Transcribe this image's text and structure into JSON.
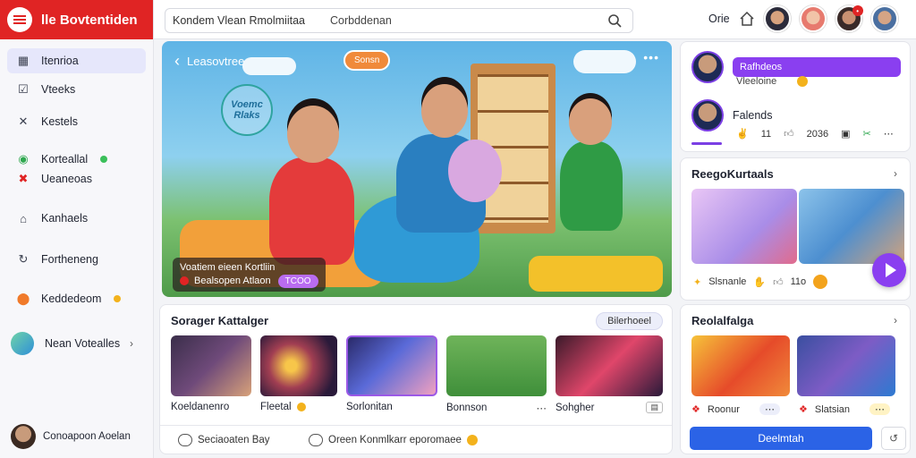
{
  "app": {
    "title": "lle Bovtentiden"
  },
  "search": {
    "query": "Kondem  Vlean  Rmolmiitaa",
    "scope": "Corbddenan"
  },
  "header": {
    "user_label": "Orie"
  },
  "sidebar": {
    "items": [
      {
        "label": "Itenrioa",
        "icon": "calendar-icon",
        "active": true
      },
      {
        "label": "Vteeks",
        "icon": "checkbox-icon"
      },
      {
        "label": "Kestels",
        "icon": "tools-icon"
      },
      {
        "label": "Korteallal",
        "icon": "whatsapp-icon",
        "dot_color": "#3bbf5a"
      },
      {
        "label": "Ueaneoas",
        "icon": "cross-icon"
      },
      {
        "label": "Kanhaels",
        "icon": "home-icon"
      },
      {
        "label": "Fortheneng",
        "icon": "refresh-icon"
      },
      {
        "label": "Keddedeom",
        "icon": "record-icon",
        "dot_color": "#f3b21c"
      },
      {
        "label": "Nean Votealles",
        "icon": "avatar-icon"
      }
    ],
    "profile_name": "Conoapoon Aoelan"
  },
  "hero": {
    "back_label": "Leasovtree",
    "top_pill": "Sonsn",
    "badge_text": "Voemc Rlaks",
    "caption_line1": "Voatiem eieen Kortliin",
    "caption_line2": "Bealsopen Atlaon",
    "caption_tag": "TCOO"
  },
  "friends_card": {
    "purple_label": "Rafhdeos",
    "sub_label": "Vleeloine",
    "title": "Falends",
    "stat1": "11",
    "stat2": "2036"
  },
  "reels1": {
    "title": "ReegoKurtaals",
    "stat_label": "Slsnanle",
    "stat_value": "11o"
  },
  "reels2": {
    "title": "Reolalfalga",
    "item1": "Roonur",
    "item2": "Slatsian",
    "button": "Deelmtah"
  },
  "section": {
    "title": "Sorager Kattalger",
    "filter": "Bilerhoeel",
    "videos": [
      {
        "label": "Koeldanenro"
      },
      {
        "label": "Fleetal"
      },
      {
        "label": "Sorlonitan"
      },
      {
        "label": "Bonnson"
      },
      {
        "label": "Sohgher"
      }
    ],
    "comment1": "Seciaoaten Bay",
    "comment2": "Oreen Konmlkarr eporomaee"
  },
  "colors": {
    "brand": "#e02424",
    "accent": "#8a3ff0",
    "primary_button": "#2b63e6"
  }
}
